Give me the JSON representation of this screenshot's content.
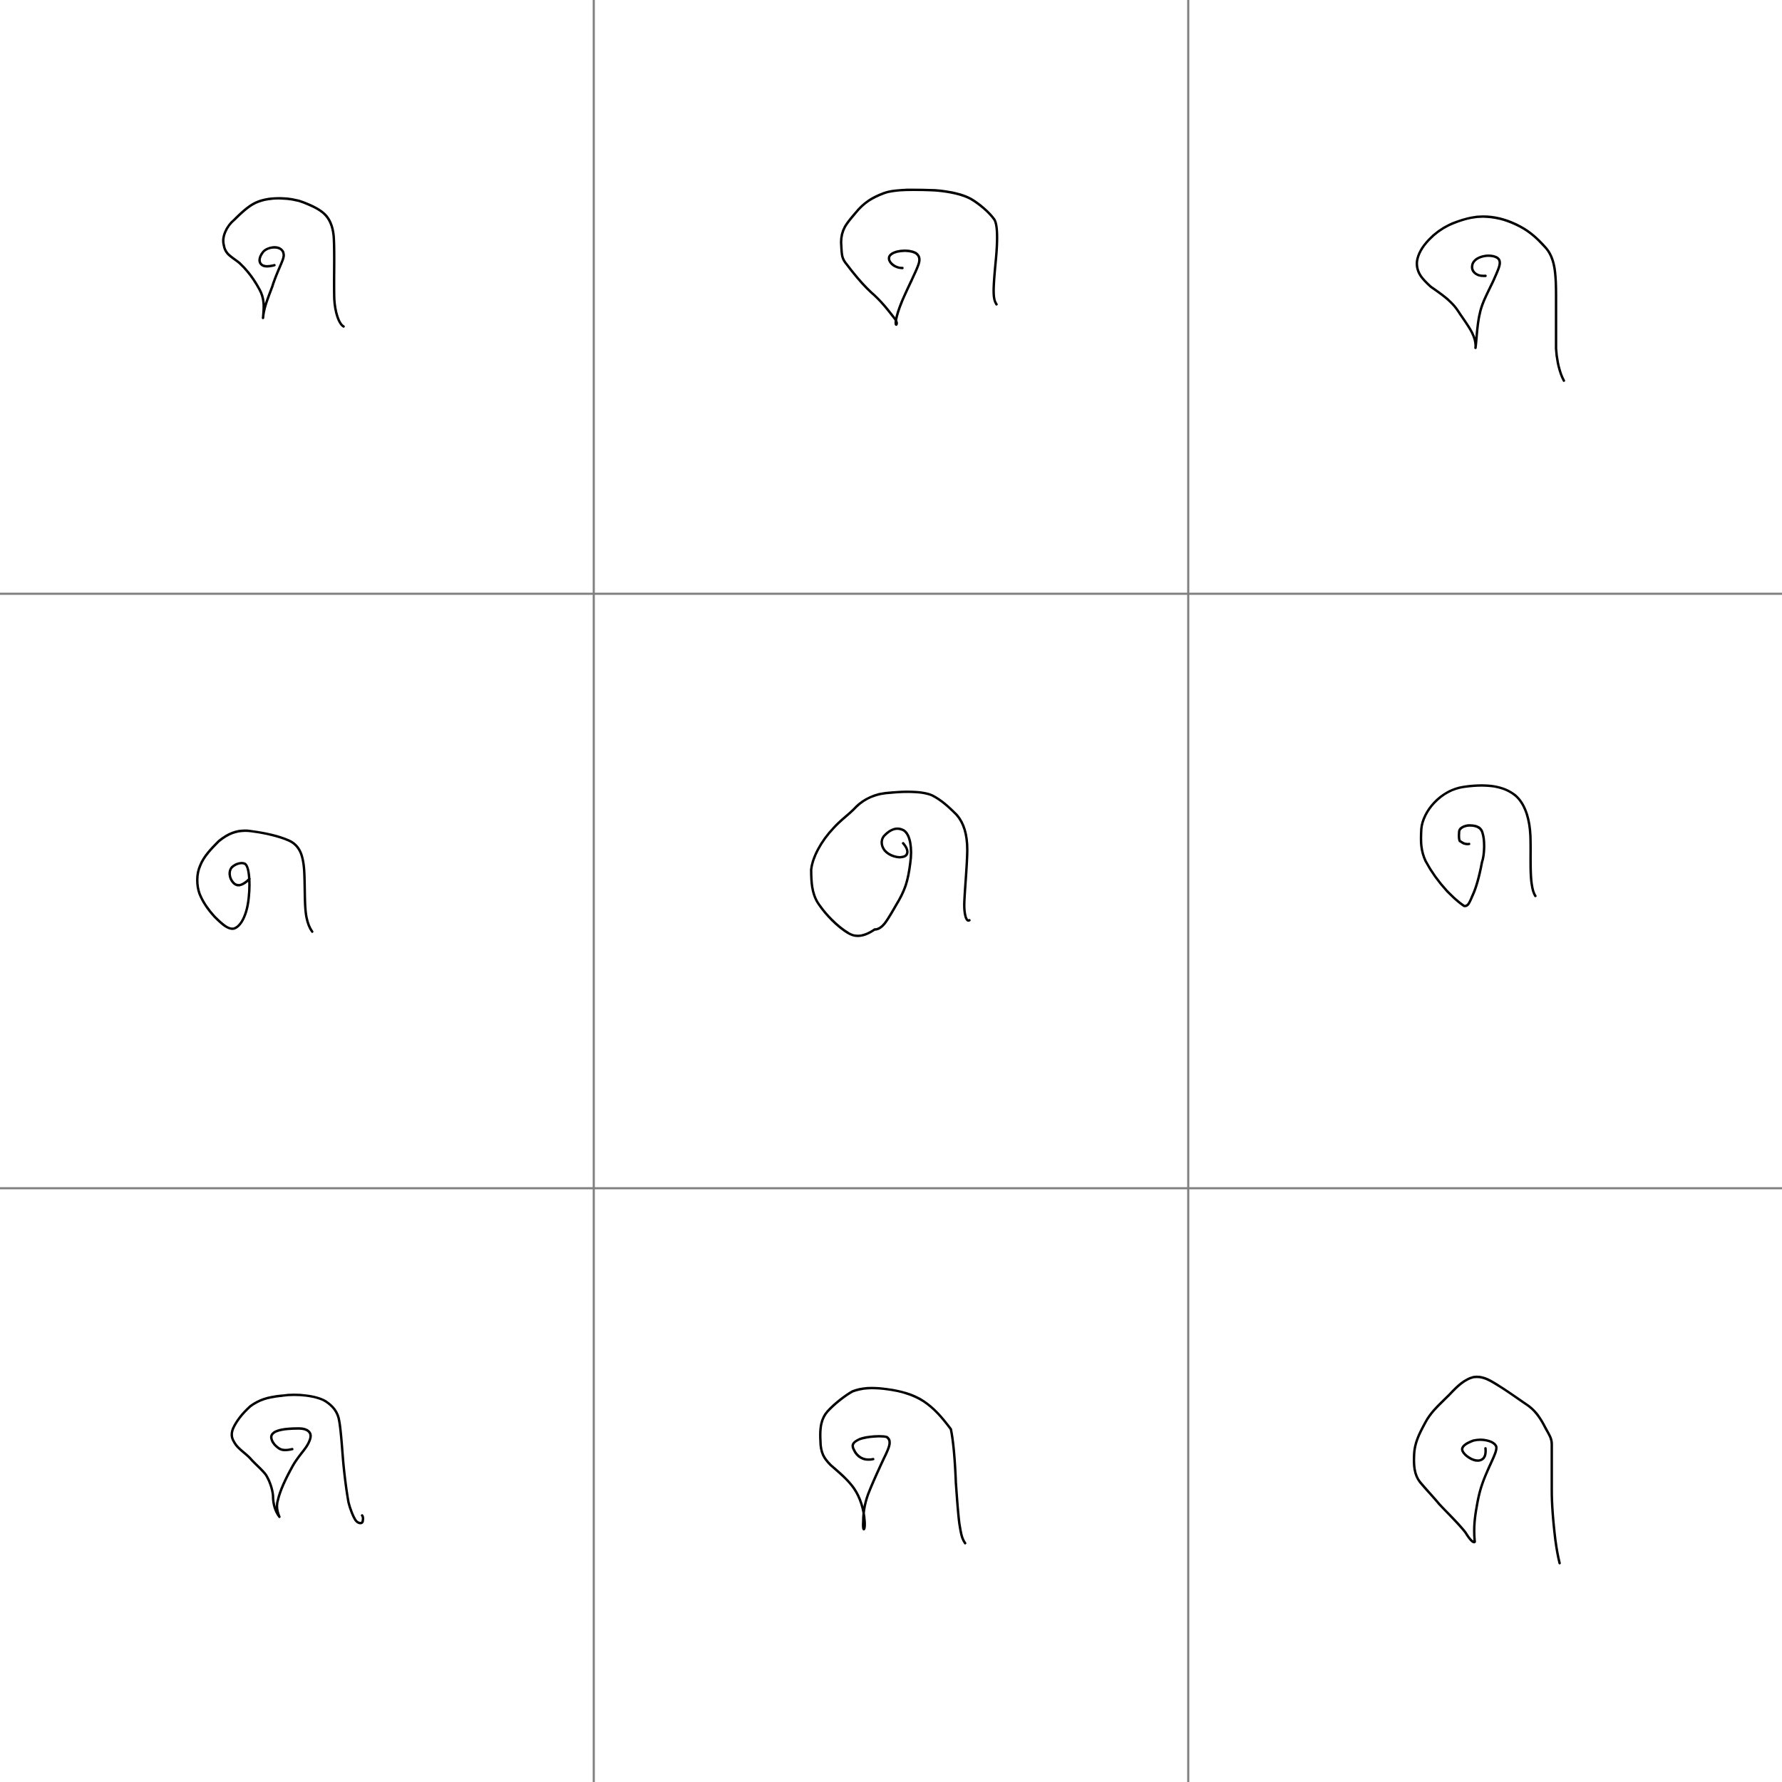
{
  "grid": {
    "rows": 3,
    "columns": 3,
    "line_color": "#808080",
    "background": "#ffffff"
  },
  "sketches": [
    {
      "name": "sketch-cell-1",
      "glyph": "handwritten-curl-with-tail",
      "ink_color": "#000000"
    },
    {
      "name": "sketch-cell-2",
      "glyph": "handwritten-curl-with-tail",
      "ink_color": "#000000"
    },
    {
      "name": "sketch-cell-3",
      "glyph": "handwritten-curl-with-tail",
      "ink_color": "#000000"
    },
    {
      "name": "sketch-cell-4",
      "glyph": "handwritten-curl-with-tail",
      "ink_color": "#000000"
    },
    {
      "name": "sketch-cell-5",
      "glyph": "handwritten-curl-with-tail",
      "ink_color": "#000000"
    },
    {
      "name": "sketch-cell-6",
      "glyph": "handwritten-curl-with-tail",
      "ink_color": "#000000"
    },
    {
      "name": "sketch-cell-7",
      "glyph": "handwritten-curl-with-tail",
      "ink_color": "#000000"
    },
    {
      "name": "sketch-cell-8",
      "glyph": "handwritten-curl-with-tail",
      "ink_color": "#000000"
    },
    {
      "name": "sketch-cell-9",
      "glyph": "handwritten-curl-with-tail",
      "ink_color": "#000000"
    }
  ]
}
